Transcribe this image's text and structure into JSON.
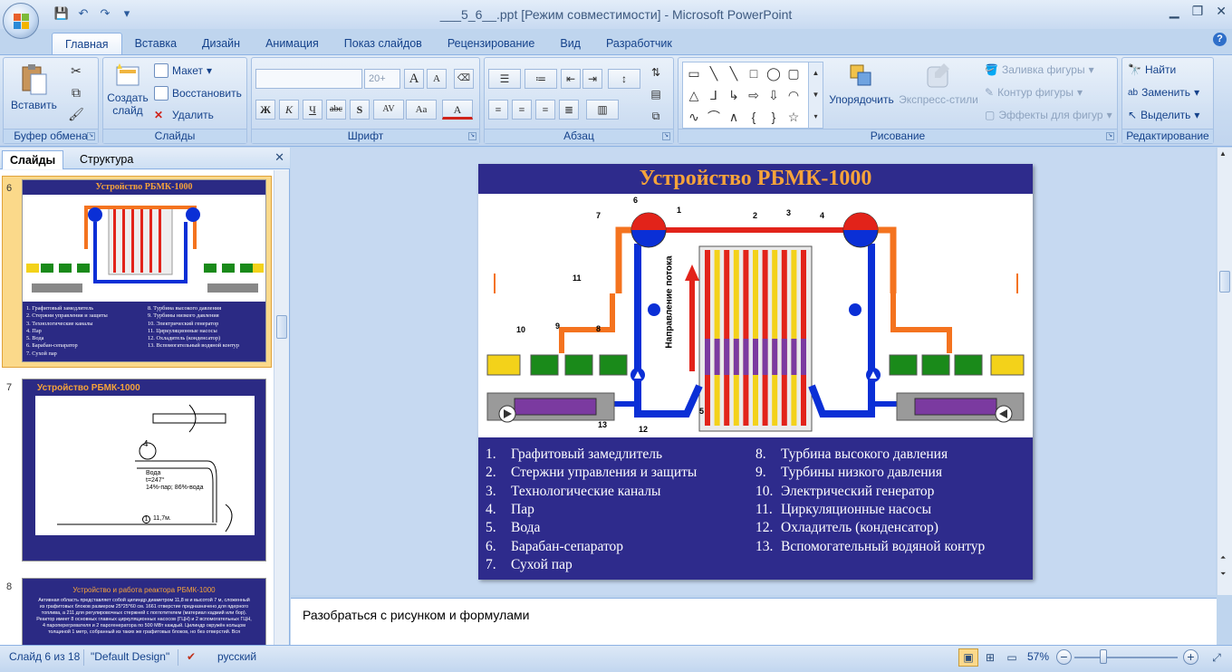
{
  "window": {
    "title": "___5_6__.ppt [Режим совместимости] - Microsoft PowerPoint",
    "controls": {
      "minimize": "▁",
      "restore": "❐",
      "close": "✕"
    }
  },
  "qat": {
    "save_icon": "💾",
    "undo_icon": "↶",
    "redo_icon": "↷",
    "more_icon": "▾"
  },
  "tabs": [
    "Главная",
    "Вставка",
    "Дизайн",
    "Анимация",
    "Показ слайдов",
    "Рецензирование",
    "Вид",
    "Разработчик"
  ],
  "help": "?",
  "ribbon": {
    "clipboard": {
      "label": "Буфер обмена",
      "paste": "Вставить"
    },
    "slides": {
      "label": "Слайды",
      "new_slide": "Создать слайд",
      "layout": "Макет",
      "reset": "Восстановить",
      "delete": "Удалить"
    },
    "font": {
      "label": "Шрифт",
      "size_placeholder": "20+",
      "bold": "Ж",
      "italic": "К",
      "underline": "Ч",
      "strike": "abc",
      "shadow": "S",
      "spacing": "AV",
      "case": "Aa",
      "color": "A",
      "grow": "A",
      "shrink": "A"
    },
    "paragraph": {
      "label": "Абзац"
    },
    "drawing": {
      "label": "Рисование",
      "arrange": "Упорядочить",
      "quick_styles": "Экспресс-стили",
      "fill": "Заливка фигуры",
      "outline": "Контур фигуры",
      "effects": "Эффекты для фигур"
    },
    "editing": {
      "label": "Редактирование",
      "find": "Найти",
      "replace": "Заменить",
      "select": "Выделить"
    }
  },
  "left_pane": {
    "tab_slides": "Слайды",
    "tab_outline": "Структура",
    "close": "✕",
    "thumbs": [
      {
        "num": "6",
        "title": "Устройство РБМК-1000",
        "legend": [
          "1. Графитовый замедлитель",
          "2. Стержни управления и защиты",
          "3. Технологические каналы",
          "4. Пар",
          "5. Вода",
          "6. Барабан-сепаратор",
          "7. Сухой пар",
          "8. Турбина высокого давления",
          "9. Турбины низкого давления",
          "10. Электрический генератор",
          "11. Циркуляционные насосы",
          "12. Охладитель (конденсатор)",
          "13. Вспомогательный водяной контур"
        ]
      },
      {
        "num": "7",
        "title": "Устройство РБМК-1000",
        "labels": {
          "circle": "4",
          "water": "Вода",
          "temp": "t=247°",
          "mix": "14%-пар; 86%-вода",
          "dim": "11,7м.",
          "dim_num": "1"
        }
      },
      {
        "num": "8",
        "title": "Устройство и работа реактора РБМК-1000",
        "body": "Активная область представляет собой цилиндр диаметром 11,8 м и высотой 7 м, сложенный из графитовых блоков размером 25*25*60 см. 1661 отверстие предназначено для ядерного топлива, а 211 для регулировочных стержней с поглотителем (материал кадмий или бор). Реактор имеет 8 основных главных циркуляционных насосов (ГЦН) и 2 вспомогательных ГЦН, 4 пароперегревателя и 2 парогенератора по 500 МВт каждый. Цилиндр окружён кольцом толщиной 1 метр, собранный из таких же графитовых блоков, но без отверстий. Вся"
      }
    ]
  },
  "slide": {
    "title": "Устройство РБМК-1000",
    "flow_label": "Направление потока",
    "legend_left": [
      {
        "n": "1.",
        "t": "Графитовый замедлитель"
      },
      {
        "n": "2.",
        "t": "Стержни управления и защиты"
      },
      {
        "n": "3.",
        "t": "Технологические каналы"
      },
      {
        "n": "4.",
        "t": "Пар"
      },
      {
        "n": "5.",
        "t": "Вода"
      },
      {
        "n": "6.",
        "t": "Барабан-сепаратор"
      },
      {
        "n": "7.",
        "t": "Сухой пар"
      }
    ],
    "legend_right": [
      {
        "n": "8.",
        "t": "Турбина высокого давления"
      },
      {
        "n": "9.",
        "t": "Турбины низкого давления"
      },
      {
        "n": "10.",
        "t": "Электрический генератор"
      },
      {
        "n": "11.",
        "t": "Циркуляционные насосы"
      },
      {
        "n": "12.",
        "t": "Охладитель (конденсатор)"
      },
      {
        "n": "13.",
        "t": "Вспомогательный водяной контур"
      }
    ],
    "callouts": [
      "1",
      "2",
      "3",
      "4",
      "5",
      "6",
      "7",
      "8",
      "9",
      "10",
      "11",
      "12",
      "13"
    ]
  },
  "notes": {
    "text": "Разобраться с рисунком и формулами"
  },
  "status": {
    "slide": "Слайд 6 из 18",
    "design": "\"Default Design\"",
    "lang": "русский",
    "zoom": "57%",
    "zoom_level": 0.57
  },
  "colors": {
    "slide_blue": "#2e2b8c",
    "title_orange": "#f6a33a",
    "steam_orange": "#f4731f",
    "water_blue": "#0a2fd6",
    "turbine_green": "#1a8a1a",
    "generator_yellow": "#f3d21a",
    "rod_red": "#e2231a"
  }
}
